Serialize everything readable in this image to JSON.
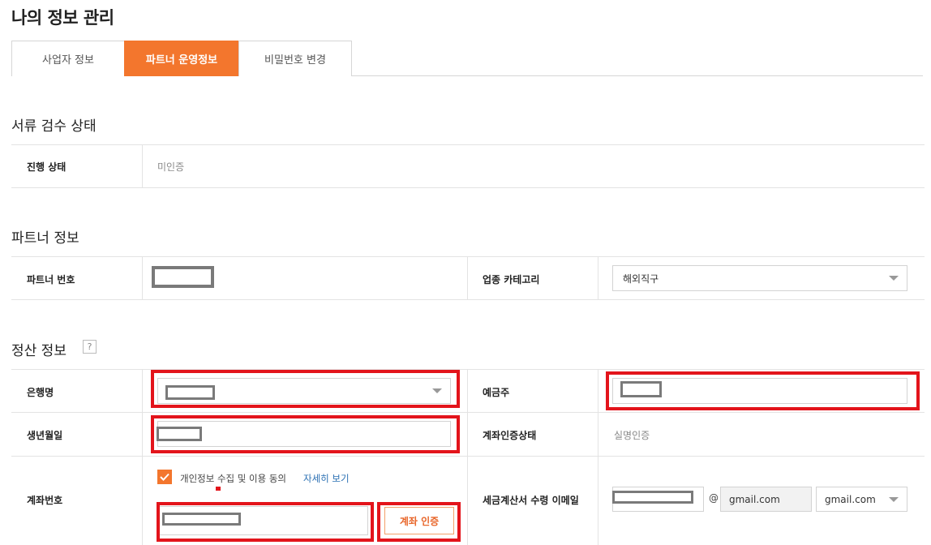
{
  "page": {
    "title": "나의 정보 관리"
  },
  "tabs": [
    {
      "label": "사업자 정보",
      "active": false
    },
    {
      "label": "파트너 운영정보",
      "active": true
    },
    {
      "label": "비밀번호 변경",
      "active": false
    }
  ],
  "colors": {
    "accent": "#f3762d",
    "highlight": "#e3141b",
    "link": "#2a6fb3"
  },
  "document_review": {
    "title": "서류 검수 상태",
    "progress_label": "진행 상태",
    "progress_value": "미인증"
  },
  "partner_info": {
    "title": "파트너 정보",
    "partner_number_label": "파트너 번호",
    "category_label": "업종 카테고리",
    "category_value": "해외직구"
  },
  "settlement": {
    "title": "정산 정보",
    "help_icon": "?",
    "bank_label": "은행명",
    "holder_label": "예금주",
    "birth_label": "생년월일",
    "account_status_label": "계좌인증상태",
    "account_status_value": "실명인증",
    "account_number_label": "계좌번호",
    "consent_text": "개인정보 수집 및 이용 동의",
    "consent_link": "자세히 보기",
    "verify_button": "계좌 인증",
    "tax_email_label": "세금계산서 수령 이메일",
    "email_at": "@",
    "email_domain": "gmail.com",
    "email_domain_select": "gmail.com"
  }
}
